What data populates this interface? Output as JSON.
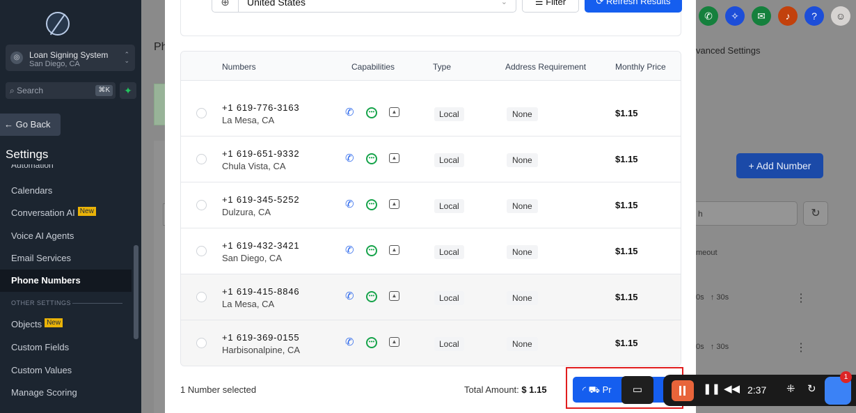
{
  "sidebar": {
    "account_name": "Loan Signing System",
    "account_location": "San Diego, CA",
    "search_placeholder": "Search",
    "search_shortcut": "⌘K",
    "go_back": "← Go Back",
    "settings_title": "Settings",
    "partial_item": "Automation",
    "items": [
      {
        "label": "Calendars"
      },
      {
        "label": "Conversation AI",
        "badge": "New"
      },
      {
        "label": "Voice AI Agents"
      },
      {
        "label": "Email Services"
      },
      {
        "label": "Phone Numbers"
      }
    ],
    "section_other": "OTHER SETTINGS",
    "items2": [
      {
        "label": "Objects",
        "badge": "New"
      },
      {
        "label": "Custom Fields"
      },
      {
        "label": "Custom Values"
      },
      {
        "label": "Manage Scoring"
      }
    ]
  },
  "background": {
    "page_title_partial": "Ph",
    "advanced_settings_partial": "vanced Settings",
    "add_number": "Add Number",
    "search_partial": "h",
    "timeout_partial": "meout",
    "row_values": [
      "0s",
      "↑ 30s"
    ]
  },
  "modal": {
    "country_value": "United States",
    "filter_label": "Filter",
    "refresh_label": "Refresh Results",
    "columns": [
      "Numbers",
      "Capabilities",
      "Type",
      "Address Requirement",
      "Monthly Price"
    ],
    "rows": [
      {
        "number": "+1 619-776-3163",
        "city": "La Mesa, CA",
        "type": "Local",
        "address": "None",
        "price": "$1.15"
      },
      {
        "number": "+1 619-651-9332",
        "city": "Chula Vista, CA",
        "type": "Local",
        "address": "None",
        "price": "$1.15"
      },
      {
        "number": "+1 619-345-5252",
        "city": "Dulzura, CA",
        "type": "Local",
        "address": "None",
        "price": "$1.15"
      },
      {
        "number": "+1 619-432-3421",
        "city": "San Diego, CA",
        "type": "Local",
        "address": "None",
        "price": "$1.15"
      },
      {
        "number": "+1 619-415-8846",
        "city": "La Mesa, CA",
        "type": "Local",
        "address": "None",
        "price": "$1.15"
      },
      {
        "number": "+1 619-369-0155",
        "city": "Harbisonalpine, CA",
        "type": "Local",
        "address": "None",
        "price": "$1.15"
      }
    ],
    "selected_count": "1",
    "selected_label": "Number selected",
    "total_label": "Total Amount:",
    "total_value": "$ 1.15",
    "purchase_partial": "Pr"
  },
  "recorder": {
    "time": "2:37",
    "notification_count": "1"
  },
  "colors": {
    "accent": "#155eef",
    "sidebar_bg": "#1c2530",
    "highlight_box": "#e11d1d"
  }
}
